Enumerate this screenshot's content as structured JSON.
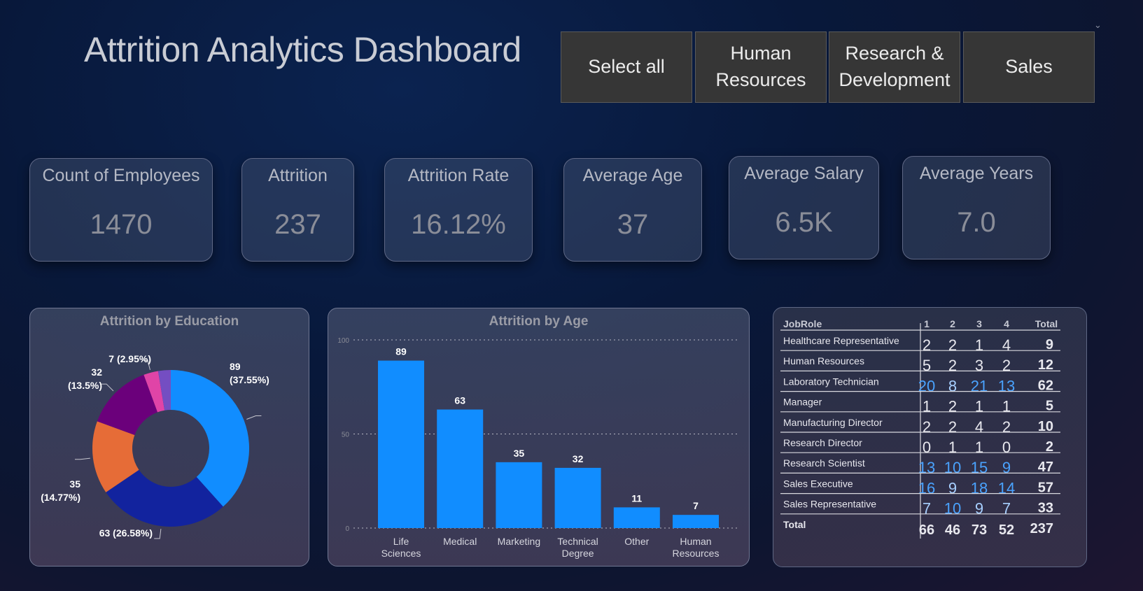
{
  "header": {
    "title": "Attrition Analytics Dashboard",
    "chevron": "⌄"
  },
  "slicer": {
    "buttons": [
      {
        "label": "Select all"
      },
      {
        "label": "Human Resources"
      },
      {
        "label": "Research & Development"
      },
      {
        "label": "Sales"
      }
    ]
  },
  "kpis": [
    {
      "label": "Count of Employees",
      "value": "1470"
    },
    {
      "label": "Attrition",
      "value": "237"
    },
    {
      "label": "Attrition Rate",
      "value": "16.12%"
    },
    {
      "label": "Average Age",
      "value": "37"
    },
    {
      "label": "Average Salary",
      "value": "6.5K"
    },
    {
      "label": "Average Years",
      "value": "7.0"
    }
  ],
  "colors": {
    "accent": "#118dff",
    "navy": "#12239e",
    "orange": "#e66c37",
    "purple": "#6b007b",
    "pink": "#e044a7",
    "violet": "#744ec2"
  },
  "chart_data": [
    {
      "type": "pie",
      "title": "Attrition by Education",
      "slices": [
        {
          "value": 89,
          "label": "89 (37.55%)",
          "color": "#118dff"
        },
        {
          "value": 63,
          "label": "63 (26.58%)",
          "color": "#12239e"
        },
        {
          "value": 35,
          "label": "35 (14.77%)",
          "color": "#e66c37"
        },
        {
          "value": 32,
          "label": "32 (13.5%)",
          "color": "#6b007b"
        },
        {
          "value": 7,
          "label": "7 (2.95%)",
          "color": "#e044a7"
        },
        {
          "value": 6,
          "label": "",
          "color": "#744ec2"
        }
      ]
    },
    {
      "type": "bar",
      "title": "Attrition by Age",
      "categories": [
        "Life Sciences",
        "Medical",
        "Marketing",
        "Technical Degree",
        "Other",
        "Human Resources"
      ],
      "values": [
        89,
        63,
        35,
        32,
        11,
        7
      ],
      "ylim": [
        0,
        100
      ],
      "yticks": [
        0,
        50,
        100
      ],
      "grid": true
    },
    {
      "type": "table",
      "columns": [
        "JobRole",
        "1",
        "2",
        "3",
        "4",
        "Total"
      ],
      "rows": [
        {
          "role": "Healthcare Representative",
          "values": [
            2,
            2,
            1,
            4
          ],
          "total": 9
        },
        {
          "role": "Human Resources",
          "values": [
            5,
            2,
            3,
            2
          ],
          "total": 12
        },
        {
          "role": "Laboratory Technician",
          "values": [
            20,
            8,
            21,
            13
          ],
          "total": 62
        },
        {
          "role": "Manager",
          "values": [
            1,
            2,
            1,
            1
          ],
          "total": 5
        },
        {
          "role": "Manufacturing Director",
          "values": [
            2,
            2,
            4,
            2
          ],
          "total": 10
        },
        {
          "role": "Research Director",
          "values": [
            0,
            1,
            1,
            0
          ],
          "total": 2
        },
        {
          "role": "Research Scientist",
          "values": [
            13,
            10,
            15,
            9
          ],
          "total": 47
        },
        {
          "role": "Sales Executive",
          "values": [
            16,
            9,
            18,
            14
          ],
          "total": 57
        },
        {
          "role": "Sales Representative",
          "values": [
            7,
            10,
            9,
            7
          ],
          "total": 33
        }
      ],
      "total_row": {
        "label": "Total",
        "values": [
          66,
          46,
          73,
          52
        ],
        "total": 237
      },
      "highlight_color": "#4aa3ff"
    }
  ]
}
